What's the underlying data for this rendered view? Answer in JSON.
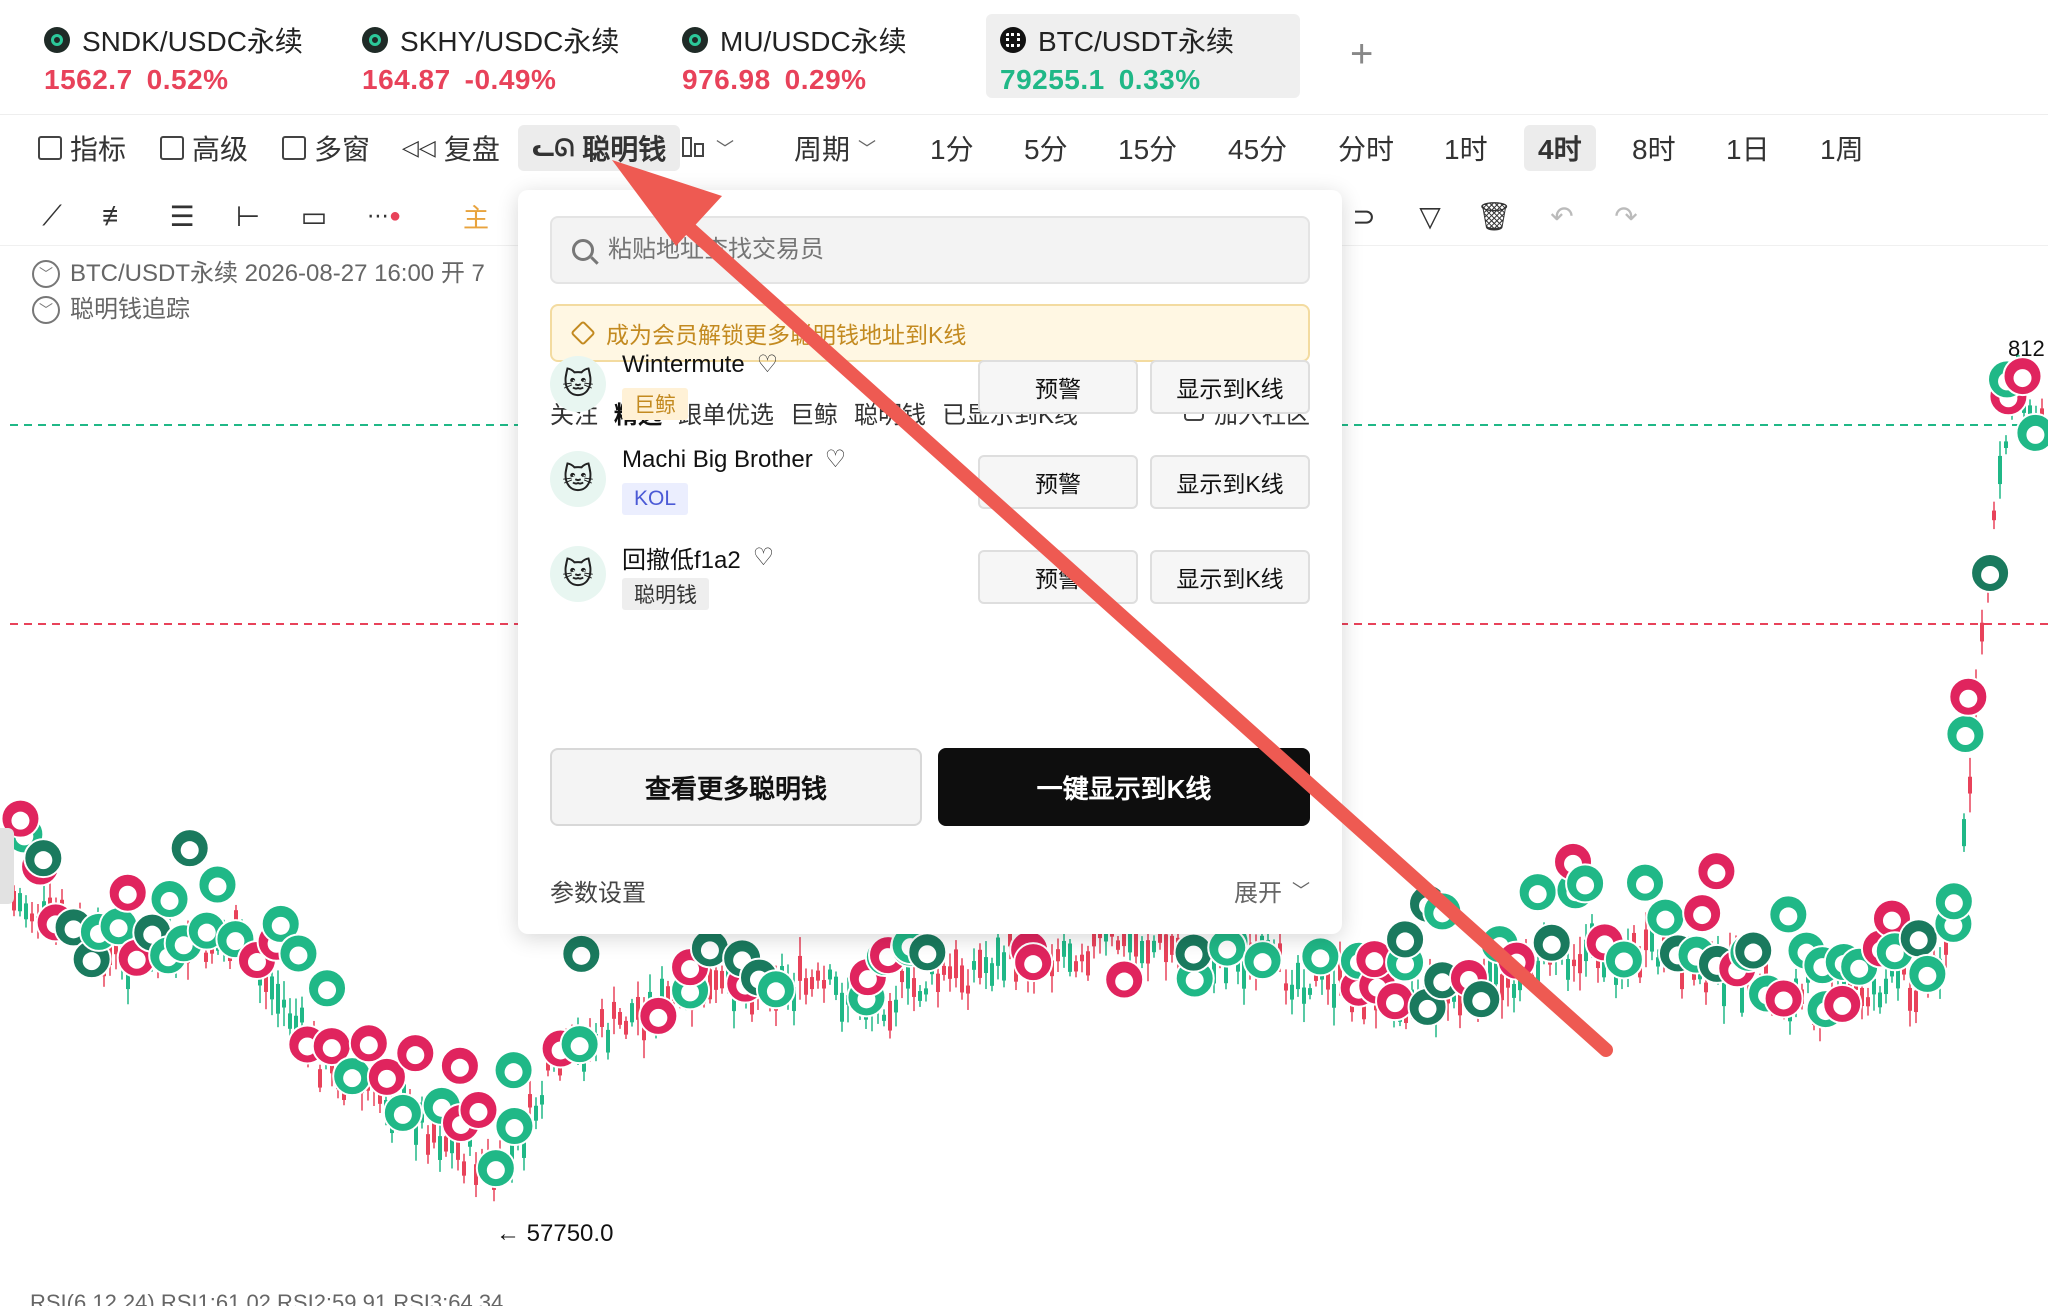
{
  "colors": {
    "up": "#20b887",
    "down": "#e8425a",
    "arrow": "#ee5a52",
    "dash_up": "#20b887",
    "dash_down": "#e8425a"
  },
  "tickers": [
    {
      "name": "SNDK/USDC永续",
      "price": "1562.7",
      "change": "0.52%",
      "direction": "down",
      "icon": "coin-icon"
    },
    {
      "name": "SKHY/USDC永续",
      "price": "164.87",
      "change": "-0.49%",
      "direction": "down",
      "icon": "coin-icon"
    },
    {
      "name": "MU/USDC永续",
      "price": "976.98",
      "change": "0.29%",
      "direction": "down",
      "icon": "coin-icon"
    },
    {
      "name": "BTC/USDT永续",
      "price": "79255.1",
      "change": "0.33%",
      "direction": "up",
      "icon": "btc-icon",
      "active": true
    }
  ],
  "tab_add": "+",
  "toolbar": {
    "indicators": "指标",
    "advanced": "高级",
    "multi_window": "多窗",
    "replay": "复盘",
    "smart_money": "聪明钱",
    "period": "周期",
    "intervals": [
      "1分",
      "5分",
      "15分",
      "45分",
      "分时",
      "1时",
      "4时",
      "8时",
      "1日",
      "1周"
    ],
    "active_interval": "4时"
  },
  "drawbar": {
    "main_label": "主"
  },
  "legend": {
    "line1": "BTC/USDT永续  2026-08-27 16:00  开 7",
    "line2": "聪明钱追踪"
  },
  "chart_labels": {
    "low": "← 57750.0",
    "right_edge": "812",
    "rsi": "RSI(6,12,24)  RSI1:61.02  RSI2:59.91  RSI3:64.34"
  },
  "popover": {
    "search_placeholder": "粘贴地址查找交易员",
    "member_banner": "成为会员解锁更多聪明钱地址到K线",
    "filter_tabs": [
      "关注",
      "精选",
      "跟单优选",
      "巨鲸",
      "聪明钱",
      "已显示到K线"
    ],
    "active_filter": "精选",
    "community": "加入社区",
    "traders": [
      {
        "name": "Wintermute",
        "tag": "巨鲸",
        "tag_type": "whale",
        "alert": "预警",
        "show": "显示到K线"
      },
      {
        "name": "Machi Big Brother",
        "tag": "KOL",
        "tag_type": "kol",
        "alert": "预警",
        "show": "显示到K线"
      },
      {
        "name": "回撤低f1a2",
        "tag": "聪明钱",
        "tag_type": "smart",
        "alert": "预警",
        "show": "显示到K线"
      }
    ],
    "view_more": "查看更多聪明钱",
    "one_click": "一键显示到K线",
    "params": "参数设置",
    "expand": "展开"
  }
}
